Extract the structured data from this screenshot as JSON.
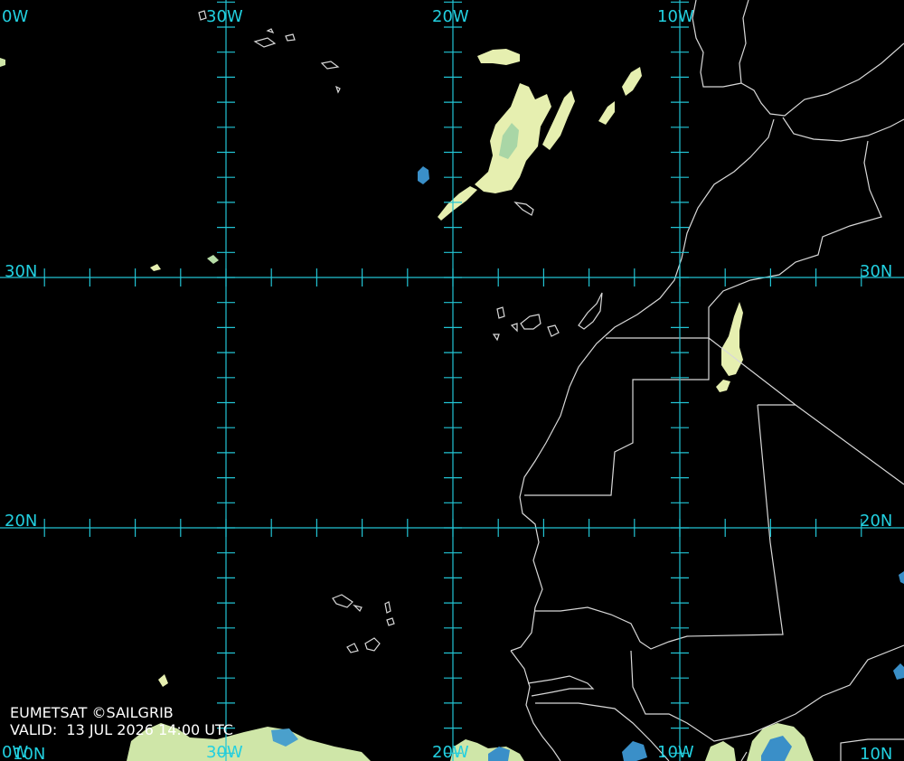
{
  "map": {
    "background": "#000000",
    "grid_color": "#22c4d4",
    "coast_color": "#d8d8d8",
    "cloud_light": "#e8f0b0",
    "cloud_mid": "#9fd0a0",
    "cloud_cold": "#3a90c8"
  },
  "labels": {
    "lon_40w_top": "0W",
    "lon_30w_top": "30W",
    "lon_20w_top": "20W",
    "lon_10w_top": "10W",
    "lat_30n_left": "30N",
    "lat_30n_right": "30N",
    "lat_20n_left": "20N",
    "lat_20n_right": "20N",
    "lon_40w_bottom": "0W",
    "lon_30w_bottom": "30W",
    "lon_20w_bottom": "20W",
    "lon_10w_bottom": "10W",
    "lat_10n_left": "10N",
    "lat_10n_right": "10N"
  },
  "credit": {
    "source": "EUMETSAT ©SAILGRIB",
    "valid": "VALID:  13 JUL 2026 14:00 UTC"
  }
}
